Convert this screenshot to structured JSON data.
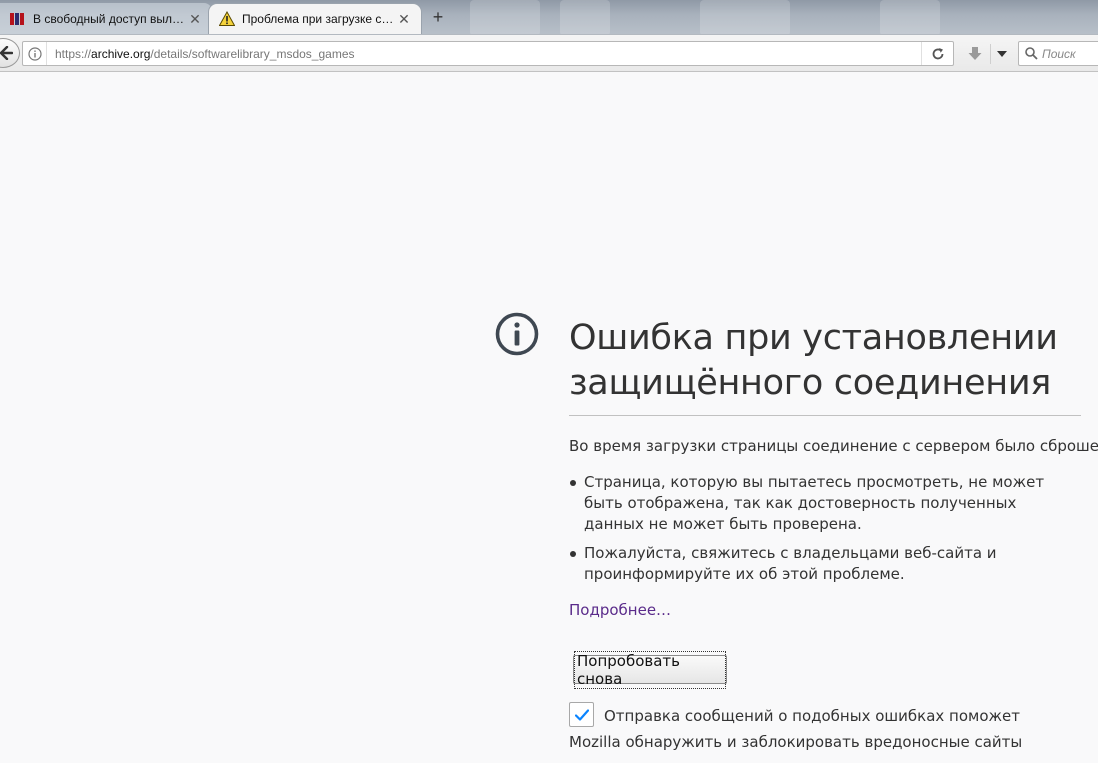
{
  "tabs": [
    {
      "title": "В свободный доступ выл…",
      "icon": "maximonline-favicon-icon",
      "active": false
    },
    {
      "title": "Проблема при загрузке с…",
      "icon": "warning-triangle-icon",
      "active": true
    }
  ],
  "tab_close_glyph": "✕",
  "new_tab_glyph": "+",
  "navbar": {
    "url_scheme": "https://",
    "url_host": "archive.org",
    "url_path": "/details/softwarelibrary_msdos_games",
    "search_placeholder": "Поиск"
  },
  "error": {
    "title": "Ошибка при установлении защищённого соединения",
    "description": "Во время загрузки страницы соединение с сервером было сброшено.",
    "bullets": [
      "Страница, которую вы пытаетесь просмотреть, не может быть отображена, так как достоверность полученных данных не может быть проверена.",
      "Пожалуйста, свяжитесь с владельцами веб-сайта и проинформируйте их об этой проблеме."
    ],
    "learn_more": "Подробнее…",
    "retry_button": "Попробовать снова",
    "report_checked": true,
    "report_text": "Отправка сообщений о подобных ошибках поможет Mozilla обнаружить и заблокировать вредоносные сайты"
  },
  "colors": {
    "accent_link": "#5a2b8a",
    "checkmark": "#0a84ff",
    "icon_gray": "#3f4852"
  }
}
